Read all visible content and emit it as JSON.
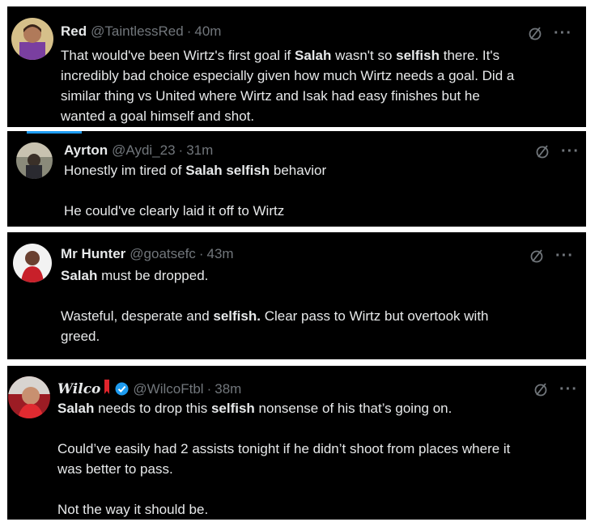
{
  "tweets": [
    {
      "name": "Red",
      "handle": "@TaintlessRed",
      "dot": "·",
      "time": "40m",
      "lines": [
        [
          "That would've been Wirtz's first goal if ",
          "Salah",
          " wasn't so ",
          "selfish",
          " there. It's"
        ],
        [
          "incredibly bad choice especially given how much Wirtz needs a goal. Did a"
        ],
        [
          "similar thing vs United where Wirtz and Isak had easy finishes but he"
        ],
        [
          "wanted a goal himself and shot."
        ]
      ]
    },
    {
      "name": "Ayrton",
      "handle": "@Aydi_23",
      "dot": "·",
      "time": "31m",
      "lines": [
        [
          "Honestly im tired of ",
          "Salah selfish",
          " behavior"
        ],
        [
          "He could've clearly laid it off to Wirtz"
        ]
      ]
    },
    {
      "name": "Mr Hunter",
      "handle": "@goatsefc",
      "dot": "·",
      "time": "43m",
      "lines": [
        [
          "",
          "Salah",
          " must be dropped."
        ],
        [
          "Wasteful, desperate and ",
          "selfish.",
          " Clear pass to Wirtz but overtook with"
        ],
        [
          "greed."
        ]
      ]
    },
    {
      "name": "Wilco",
      "handle": "@WilcoFtbl",
      "dot": "·",
      "time": "38m",
      "lines": [
        [
          "",
          "Salah",
          " needs to drop this ",
          "selfish",
          " nonsense of his that’s going on."
        ],
        [
          "Could’ve easily had 2 assists tonight if he didn’t shoot from places where it"
        ],
        [
          "was better to pass."
        ],
        [
          "Not the way it should be."
        ]
      ]
    }
  ],
  "more_label": "···",
  "colors": {
    "background": "#000000",
    "text": "#e7e9ea",
    "muted": "#71767b",
    "verified": "#1d9bf0"
  },
  "icons": {
    "slash": "grok-slash-icon",
    "more": "more-options-icon",
    "verified": "verified-badge-icon"
  }
}
